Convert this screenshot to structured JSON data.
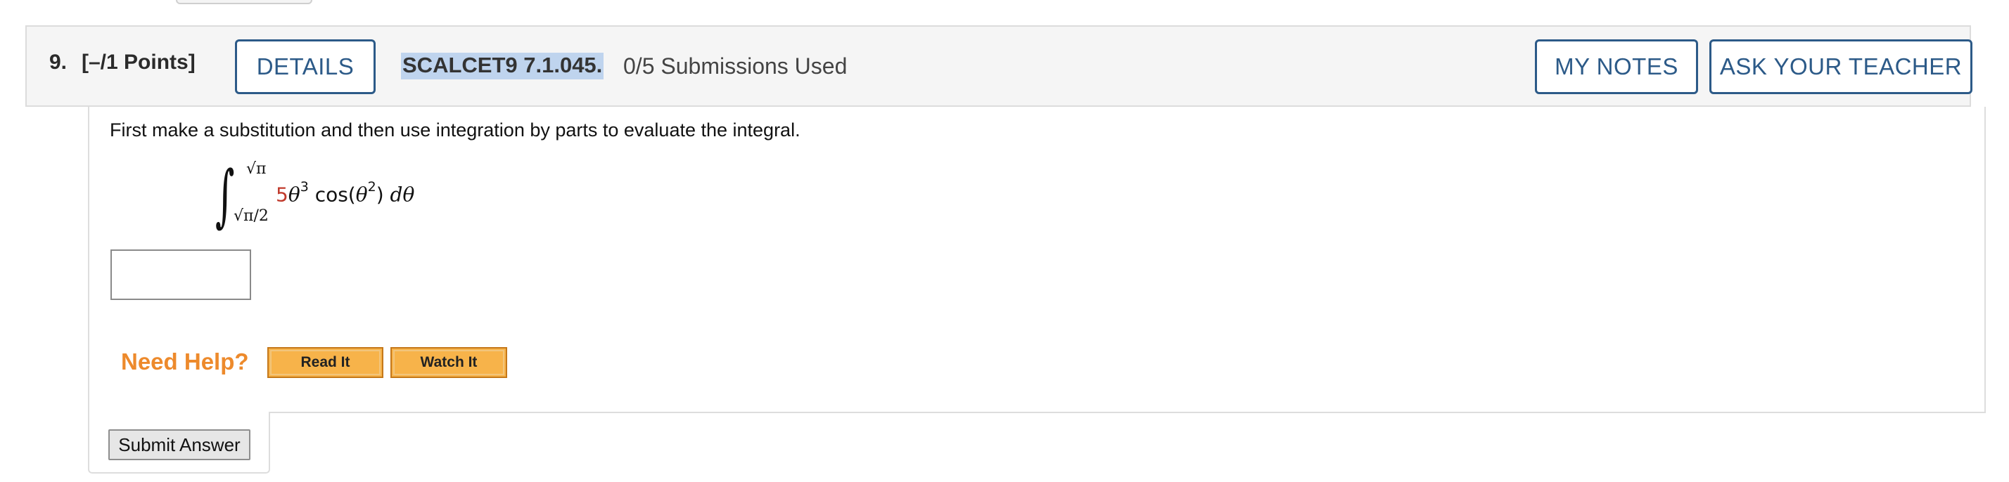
{
  "question": {
    "number": "9.",
    "points": "[–/1 Points]",
    "details_label": "DETAILS",
    "id": "SCALCET9 7.1.045.",
    "submissions": "0/5 Submissions Used",
    "my_notes_label": "MY NOTES",
    "ask_teacher_label": "ASK YOUR TEACHER",
    "prompt": "First make a substitution and then use integration by parts to evaluate the integral.",
    "integral": {
      "sign": "∫",
      "upper_limit": "√π",
      "lower_limit": "√π/2",
      "coefficient": "5",
      "coefficient_color": "#c0392b",
      "var1": "θ",
      "exp1": "3",
      "func": "cos(",
      "var2": "θ",
      "exp2": "2",
      "close": ") ",
      "dvar": "dθ"
    },
    "answer_value": ""
  },
  "help": {
    "label": "Need Help?",
    "read_label": "Read It",
    "watch_label": "Watch It"
  },
  "submit_label": "Submit Answer",
  "colors": {
    "header_button_border": "#2c5a88",
    "help_text": "#ed8a2c",
    "help_button_fill": "#f7b34a",
    "id_highlight": "#bfd4ee"
  }
}
